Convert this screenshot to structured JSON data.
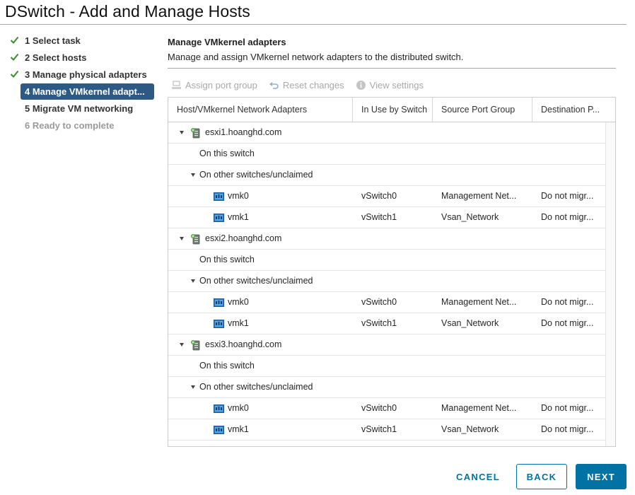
{
  "window": {
    "title": "DSwitch - Add and Manage Hosts"
  },
  "steps": [
    {
      "label": "1 Select task",
      "state": "done"
    },
    {
      "label": "2 Select hosts",
      "state": "done"
    },
    {
      "label": "3 Manage physical adapters",
      "state": "done"
    },
    {
      "label": "4 Manage VMkernel adapt...",
      "state": "active"
    },
    {
      "label": "5 Migrate VM networking",
      "state": "pending"
    },
    {
      "label": "6 Ready to complete",
      "state": "disabled"
    }
  ],
  "main": {
    "title": "Manage VMkernel adapters",
    "description": "Manage and assign VMkernel network adapters to the distributed switch."
  },
  "toolbar": {
    "assign_port_group": "Assign port group",
    "reset_changes": "Reset changes",
    "view_settings": "View settings"
  },
  "grid": {
    "columns": [
      "Host/VMkernel Network Adapters",
      "In Use by Switch",
      "Source Port Group",
      "Destination P..."
    ],
    "hosts": [
      {
        "name": "esxi1.hoanghd.com",
        "on_this_switch": "On this switch",
        "other_group": "On other switches/unclaimed",
        "adapters": [
          {
            "name": "vmk0",
            "switch": "vSwitch0",
            "source": "Management Net...",
            "destination": "Do not migr..."
          },
          {
            "name": "vmk1",
            "switch": "vSwitch1",
            "source": "Vsan_Network",
            "destination": "Do not migr..."
          }
        ]
      },
      {
        "name": "esxi2.hoanghd.com",
        "on_this_switch": "On this switch",
        "other_group": "On other switches/unclaimed",
        "adapters": [
          {
            "name": "vmk0",
            "switch": "vSwitch0",
            "source": "Management Net...",
            "destination": "Do not migr..."
          },
          {
            "name": "vmk1",
            "switch": "vSwitch1",
            "source": "Vsan_Network",
            "destination": "Do not migr..."
          }
        ]
      },
      {
        "name": "esxi3.hoanghd.com",
        "on_this_switch": "On this switch",
        "other_group": "On other switches/unclaimed",
        "adapters": [
          {
            "name": "vmk0",
            "switch": "vSwitch0",
            "source": "Management Net...",
            "destination": "Do not migr..."
          },
          {
            "name": "vmk1",
            "switch": "vSwitch1",
            "source": "Vsan_Network",
            "destination": "Do not migr..."
          }
        ]
      }
    ]
  },
  "footer": {
    "cancel": "CANCEL",
    "back": "BACK",
    "next": "NEXT"
  },
  "colors": {
    "accent": "#0072a3",
    "active_step": "#2d5a84",
    "check": "#3c8c2f"
  }
}
